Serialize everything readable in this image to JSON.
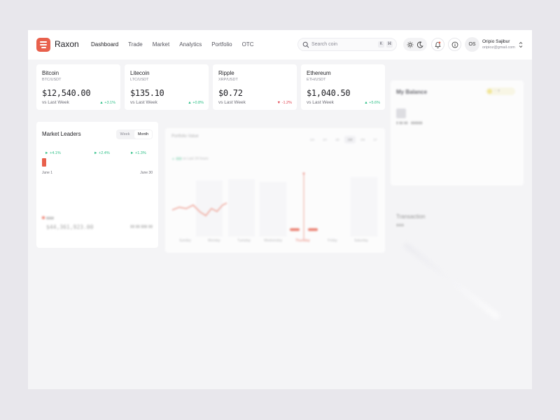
{
  "header": {
    "brand": "Raxon",
    "nav": [
      "Dashboard",
      "Trade",
      "Market",
      "Analytics",
      "Portfolio",
      "OTC"
    ],
    "active_nav": "Dashboard",
    "search_placeholder": "Search coin",
    "shortcut_keys": [
      "K",
      "⌘"
    ],
    "user": {
      "initials": "OS",
      "name": "Oripio Sajibur",
      "email": "oripioz@gmail.com"
    }
  },
  "coins": [
    {
      "name": "Bitcoin",
      "pair": "BTC/USDT",
      "price": "$12,540.00",
      "vs": "vs Last Week",
      "change": "+3.1%",
      "dir": "up"
    },
    {
      "name": "Litecoin",
      "pair": "LTC/USDT",
      "price": "$135.10",
      "vs": "vs Last Week",
      "change": "+0.8%",
      "dir": "up"
    },
    {
      "name": "Ripple",
      "pair": "XRP/USDT",
      "price": "$0.72",
      "vs": "vs Last Week",
      "change": "-1.2%",
      "dir": "down"
    },
    {
      "name": "Ethereum",
      "pair": "ETH/USDT",
      "price": "$1,040.50",
      "vs": "vs Last Week",
      "change": "+5.6%",
      "dir": "up"
    }
  ],
  "balance": {
    "title": "My Balance"
  },
  "transactions": {
    "title": "Transaction"
  },
  "market_leaders": {
    "title": "Market Leaders",
    "tabs": [
      "Week",
      "Month"
    ],
    "active_tab": "Month",
    "changes": [
      "+4.1%",
      "+2.4%",
      "+1.3%"
    ],
    "start_date": "June 1",
    "end_date": "June 30",
    "value": "$44,361,923.00"
  },
  "portfolio": {
    "title": "Portfolio Value",
    "ranges": [
      "1m",
      "1H",
      "1D",
      "1W",
      "1M",
      "1Y"
    ],
    "active_range": "1W",
    "change_note": "vs Last 24 hours",
    "days": [
      "Sunday",
      "Monday",
      "Tuesday",
      "Wednesday",
      "Thursday",
      "Friday",
      "Saturday"
    ],
    "active_day": "Thursday"
  },
  "colors": {
    "brand": "#e8604c",
    "up": "#2cbf86",
    "down": "#e0424e",
    "card": "#ffffff",
    "background": "#f4f4f6"
  }
}
